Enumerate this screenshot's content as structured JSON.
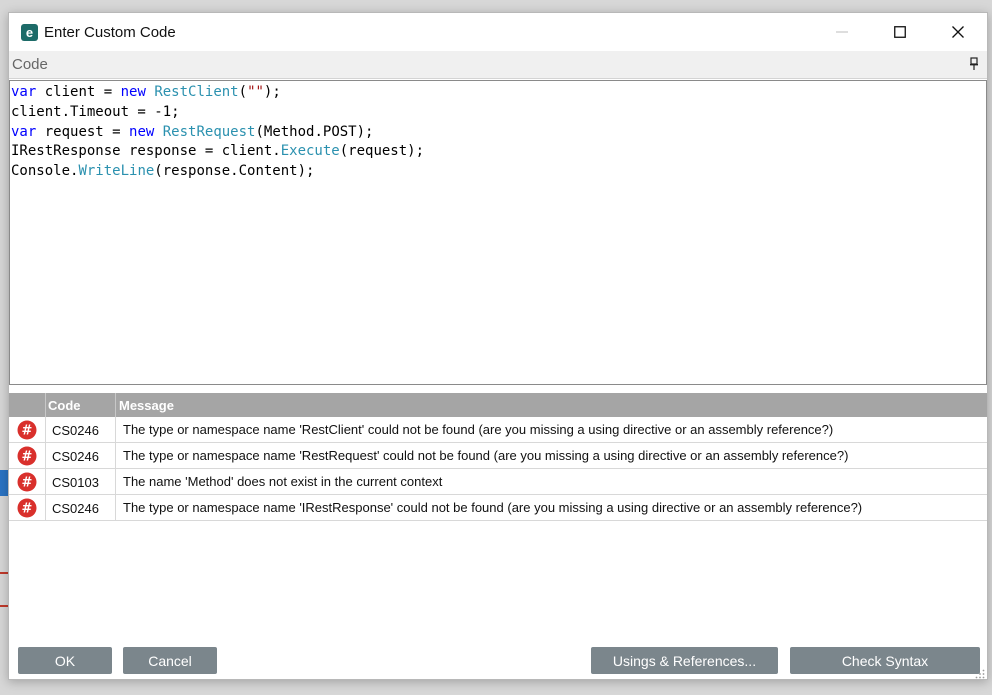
{
  "window": {
    "title": "Enter Custom Code",
    "icon_letter": "e"
  },
  "panel": {
    "label": "Code"
  },
  "code": {
    "lines": [
      [
        {
          "t": "var",
          "c": "kw"
        },
        {
          "t": " client = "
        },
        {
          "t": "new",
          "c": "kw"
        },
        {
          "t": " "
        },
        {
          "t": "RestClient",
          "c": "ty"
        },
        {
          "t": "("
        },
        {
          "t": "\"\"",
          "c": "str"
        },
        {
          "t": ");"
        }
      ],
      [
        {
          "t": "client.Timeout = -1;"
        }
      ],
      [
        {
          "t": "var",
          "c": "kw"
        },
        {
          "t": " request = "
        },
        {
          "t": "new",
          "c": "kw"
        },
        {
          "t": " "
        },
        {
          "t": "RestRequest",
          "c": "ty"
        },
        {
          "t": "(Method.POST);"
        }
      ],
      [
        {
          "t": "IRestResponse response = client."
        },
        {
          "t": "Execute",
          "c": "mt"
        },
        {
          "t": "(request);"
        }
      ],
      [
        {
          "t": "Console."
        },
        {
          "t": "WriteLine",
          "c": "mt"
        },
        {
          "t": "(response.Content);"
        }
      ]
    ]
  },
  "errors": {
    "headers": {
      "code": "Code",
      "message": "Message"
    },
    "rows": [
      {
        "code": "CS0246",
        "message": "The type or namespace name 'RestClient' could not be found (are you missing a using directive or an assembly reference?)"
      },
      {
        "code": "CS0246",
        "message": "The type or namespace name 'RestRequest' could not be found (are you missing a using directive or an assembly reference?)"
      },
      {
        "code": "CS0103",
        "message": "The name 'Method' does not exist in the current context"
      },
      {
        "code": "CS0246",
        "message": "The type or namespace name 'IRestResponse' could not be found (are you missing a using directive or an assembly reference?)"
      }
    ],
    "icon": "error-hash-icon"
  },
  "buttons": {
    "ok": "OK",
    "cancel": "Cancel",
    "usings": "Usings & References...",
    "check": "Check Syntax"
  },
  "colors": {
    "button": "#7b868c",
    "error_icon": "#d9302c",
    "keyword": "#0000ff",
    "type": "#2b91af",
    "string": "#a31515"
  }
}
